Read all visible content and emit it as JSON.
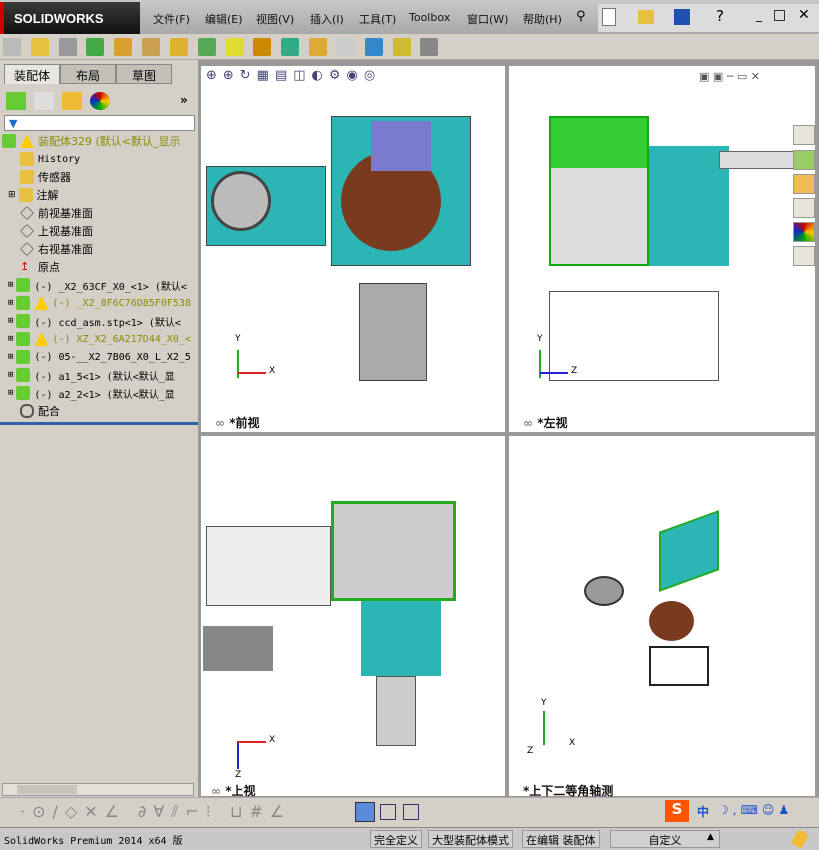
{
  "app": {
    "logo": "SOLIDWORKS"
  },
  "menu": [
    "文件(F)",
    "编辑(E)",
    "视图(V)",
    "插入(I)",
    "工具(T)",
    "Toolbox",
    "窗口(W)",
    "帮助(H)"
  ],
  "panel": {
    "tabs": [
      "装配体",
      "布局",
      "草图"
    ],
    "more": "»"
  },
  "tree": [
    {
      "label": "装配体329  (默认<默认_显示",
      "warn": true,
      "type": "assembly"
    },
    {
      "label": "History",
      "type": "history"
    },
    {
      "label": "传感器",
      "type": "sensor"
    },
    {
      "label": "注解",
      "type": "annotation"
    },
    {
      "label": "前视基准面",
      "type": "plane"
    },
    {
      "label": "上视基准面",
      "type": "plane"
    },
    {
      "label": "右视基准面",
      "type": "plane"
    },
    {
      "label": "原点",
      "type": "origin"
    },
    {
      "label": "(-) _X2_63CF_X0_<1> (默认<",
      "type": "part"
    },
    {
      "label": "(-) _X2_8F6C76D85F0F538",
      "warn": true,
      "type": "part"
    },
    {
      "label": "(-) ccd_asm.stp<1> (默认<",
      "type": "part"
    },
    {
      "label": "(-) XZ_X2_6A217D44_X0_<",
      "warn": true,
      "type": "part"
    },
    {
      "label": "(-) 05-__X2_7B06_X0_L_X2_5",
      "type": "part"
    },
    {
      "label": "(-) a1_5<1> (默认<默认_显",
      "type": "part"
    },
    {
      "label": "(-) a2_2<1> (默认<默认_显",
      "type": "part"
    },
    {
      "label": "配合",
      "type": "mates"
    }
  ],
  "views": {
    "front": "*前视",
    "left": "*左视",
    "top": "*上视",
    "iso": "*上下二等角轴测"
  },
  "axes": {
    "x": "X",
    "y": "Y",
    "z": "Z"
  },
  "status": {
    "app": "SolidWorks Premium 2014 x64 版",
    "defined": "完全定义",
    "mode": "大型装配体模式",
    "editing": "在编辑 装配体",
    "custom": "自定义",
    "arrow": "▲"
  },
  "ime": {
    "lang": "中"
  }
}
